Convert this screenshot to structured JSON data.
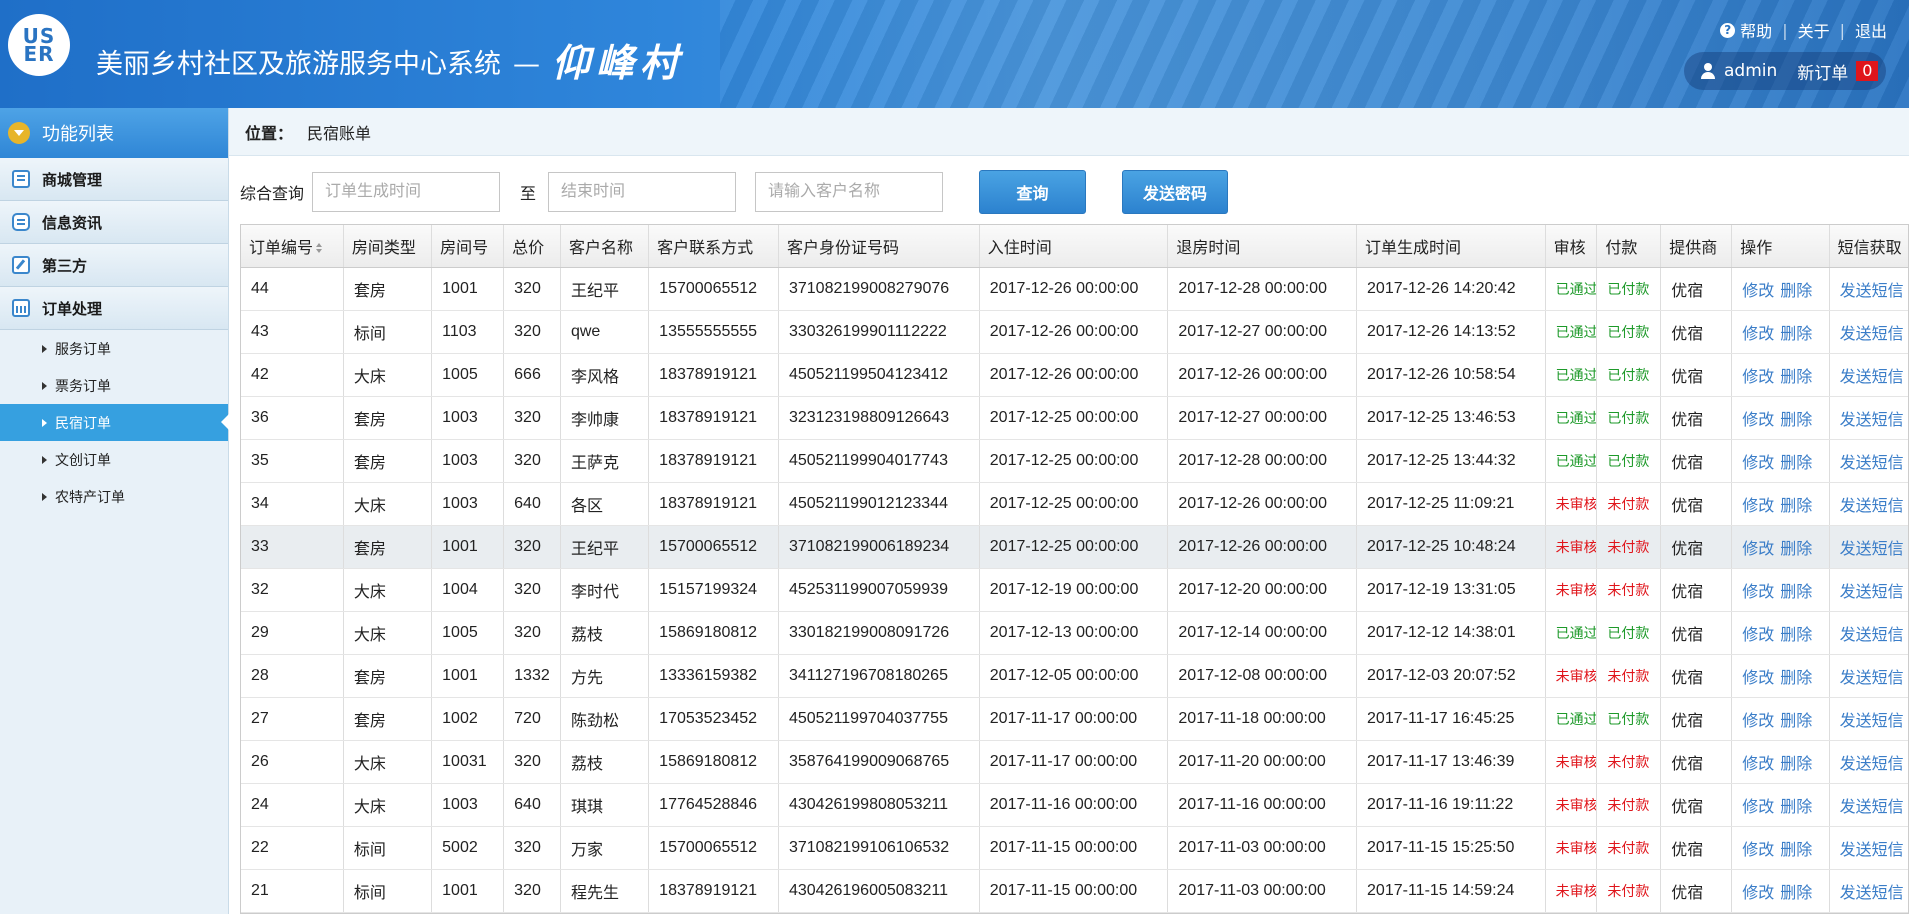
{
  "header": {
    "logo_text": "US\nER",
    "title": "美丽乡村社区及旅游服务中心系统",
    "separator": "—",
    "village": "仰峰村",
    "help": "帮助",
    "about": "关于",
    "logout": "退出",
    "user": "admin",
    "new_order_label": "新订单",
    "new_order_count": "0"
  },
  "sidebar": {
    "head": "功能列表",
    "sections": [
      "商城管理",
      "信息资讯",
      "第三方",
      "订单处理"
    ],
    "sub_items": [
      "服务订单",
      "票务订单",
      "民宿订单",
      "文创订单",
      "农特产订单"
    ],
    "active": "民宿订单"
  },
  "breadcrumb": {
    "label": "位置：",
    "value": "民宿账单"
  },
  "filter": {
    "label": "综合查询",
    "start_placeholder": "订单生成时间",
    "to": "至",
    "end_placeholder": "结束时间",
    "customer_placeholder": "请输入客户名称",
    "query_btn": "查询",
    "send_btn": "发送密码"
  },
  "table": {
    "columns": [
      "订单编号",
      "房间类型",
      "房间号",
      "总价",
      "客户名称",
      "客户联系方式",
      "客户身份证号码",
      "入住时间",
      "退房时间",
      "订单生成时间",
      "审核",
      "付款",
      "提供商",
      "操作",
      "短信获取"
    ],
    "edit": "修改",
    "delete": "删除",
    "sms": "发送短信",
    "rows": [
      [
        "44",
        "套房",
        "1001",
        "320",
        "王纪平",
        "15700065512",
        "371082199008279076",
        "2017-12-26 00:00:00",
        "2017-12-28 00:00:00",
        "2017-12-26 14:20:42",
        "已通过",
        "已付款",
        "优宿"
      ],
      [
        "43",
        "标间",
        "1103",
        "320",
        "qwe",
        "13555555555",
        "330326199901112222",
        "2017-12-26 00:00:00",
        "2017-12-27 00:00:00",
        "2017-12-26 14:13:52",
        "已通过",
        "已付款",
        "优宿"
      ],
      [
        "42",
        "大床",
        "1005",
        "666",
        "李风格",
        "18378919121",
        "450521199504123412",
        "2017-12-26 00:00:00",
        "2017-12-26 00:00:00",
        "2017-12-26 10:58:54",
        "已通过",
        "已付款",
        "优宿"
      ],
      [
        "36",
        "套房",
        "1003",
        "320",
        "李帅康",
        "18378919121",
        "323123198809126643",
        "2017-12-25 00:00:00",
        "2017-12-27 00:00:00",
        "2017-12-25 13:46:53",
        "已通过",
        "已付款",
        "优宿"
      ],
      [
        "35",
        "套房",
        "1003",
        "320",
        "王萨克",
        "18378919121",
        "450521199904017743",
        "2017-12-25 00:00:00",
        "2017-12-28 00:00:00",
        "2017-12-25 13:44:32",
        "已通过",
        "已付款",
        "优宿"
      ],
      [
        "34",
        "大床",
        "1003",
        "640",
        "各区",
        "18378919121",
        "450521199012123344",
        "2017-12-25 00:00:00",
        "2017-12-26 00:00:00",
        "2017-12-25 11:09:21",
        "未审核",
        "未付款",
        "优宿"
      ],
      [
        "33",
        "套房",
        "1001",
        "320",
        "王纪平",
        "15700065512",
        "371082199006189234",
        "2017-12-25 00:00:00",
        "2017-12-26 00:00:00",
        "2017-12-25 10:48:24",
        "未审核",
        "未付款",
        "优宿"
      ],
      [
        "32",
        "大床",
        "1004",
        "320",
        "李时代",
        "15157199324",
        "452531199007059939",
        "2017-12-19 00:00:00",
        "2017-12-20 00:00:00",
        "2017-12-19 13:31:05",
        "未审核",
        "未付款",
        "优宿"
      ],
      [
        "29",
        "大床",
        "1005",
        "320",
        "荔枝",
        "15869180812",
        "330182199008091726",
        "2017-12-13 00:00:00",
        "2017-12-14 00:00:00",
        "2017-12-12 14:38:01",
        "已通过",
        "已付款",
        "优宿"
      ],
      [
        "28",
        "套房",
        "1001",
        "1332",
        "方先",
        "13336159382",
        "341127196708180265",
        "2017-12-05 00:00:00",
        "2017-12-08 00:00:00",
        "2017-12-03 20:07:52",
        "未审核",
        "未付款",
        "优宿"
      ],
      [
        "27",
        "套房",
        "1002",
        "720",
        "陈劲松",
        "17053523452",
        "450521199704037755",
        "2017-11-17 00:00:00",
        "2017-11-18 00:00:00",
        "2017-11-17 16:45:25",
        "已通过",
        "已付款",
        "优宿"
      ],
      [
        "26",
        "大床",
        "10031",
        "320",
        "荔枝",
        "15869180812",
        "358764199009068765",
        "2017-11-17 00:00:00",
        "2017-11-20 00:00:00",
        "2017-11-17 13:46:39",
        "未审核",
        "未付款",
        "优宿"
      ],
      [
        "24",
        "大床",
        "1003",
        "640",
        "琪琪",
        "17764528846",
        "430426199808053211",
        "2017-11-16 00:00:00",
        "2017-11-16 00:00:00",
        "2017-11-16 19:11:22",
        "未审核",
        "未付款",
        "优宿"
      ],
      [
        "22",
        "标间",
        "5002",
        "320",
        "万家",
        "15700065512",
        "371082199106106532",
        "2017-11-15 00:00:00",
        "2017-11-03 00:00:00",
        "2017-11-15 15:25:50",
        "未审核",
        "未付款",
        "优宿"
      ],
      [
        "21",
        "标间",
        "1001",
        "320",
        "程先生",
        "18378919121",
        "430426196005083211",
        "2017-11-15 00:00:00",
        "2017-11-03 00:00:00",
        "2017-11-15 14:59:24",
        "未审核",
        "未付款",
        "优宿"
      ]
    ],
    "highlight_row": "33"
  },
  "colors": {
    "approved": "#1e9a2a",
    "pending": "#e0151b",
    "link": "#3a7dc8",
    "accent": "#36a0e0"
  }
}
